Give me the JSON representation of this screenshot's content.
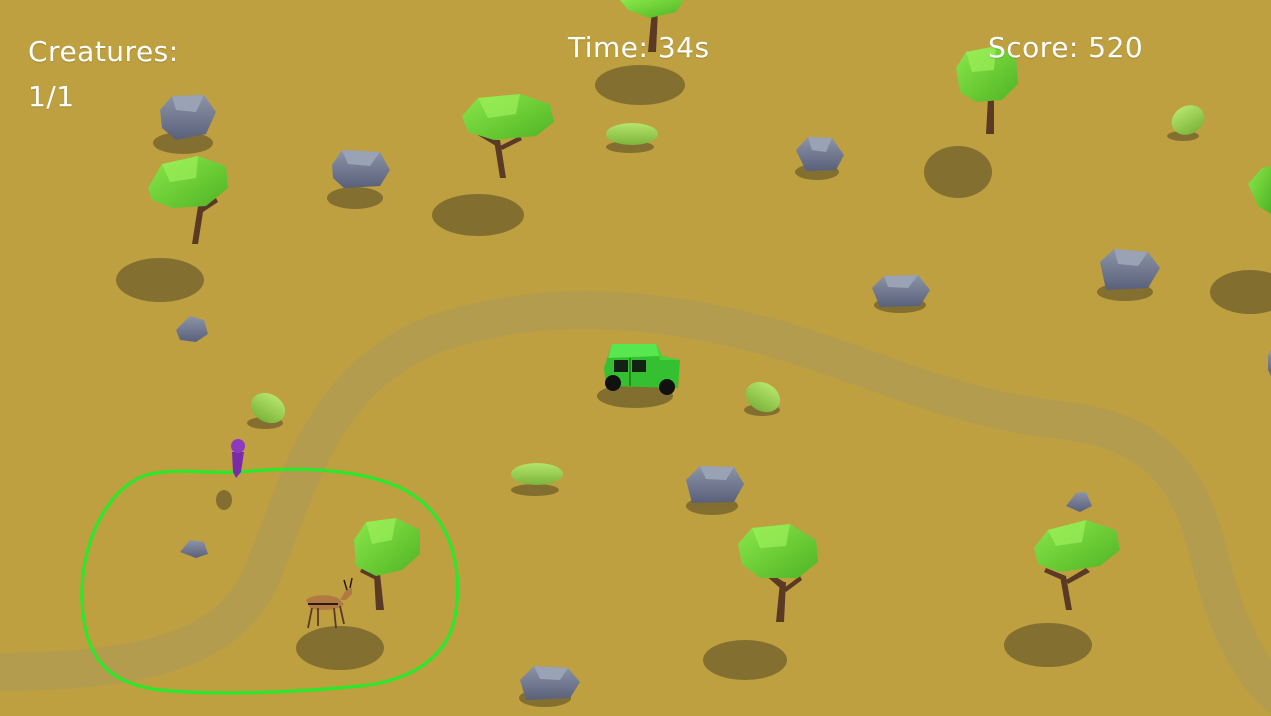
{
  "hud": {
    "creatures_label": "Creatures:",
    "creatures_value": "1/1",
    "time": "Time: 34s",
    "score": "Score: 520"
  },
  "colors": {
    "ground": "#BEA040",
    "trail": "#B39B52",
    "shadow": "#6F5F2A",
    "foliage": "#7AD93A",
    "foliage_dark": "#4BA21F",
    "trunk": "#5A3A24",
    "rock": "#6A7285",
    "rock_light": "#8A92A6",
    "bush": "#9ACD4E",
    "jeep": "#3ED13A",
    "selection_ring": "#2BE82B",
    "player": "#7A2BA8",
    "hud_text": "#FFFFFF"
  },
  "icons": {
    "player": "player-marker-icon",
    "vehicle": "jeep-icon",
    "creature": "gazelle-icon",
    "tree": "acacia-tree-icon",
    "rock": "rock-icon",
    "bush": "bush-icon"
  }
}
